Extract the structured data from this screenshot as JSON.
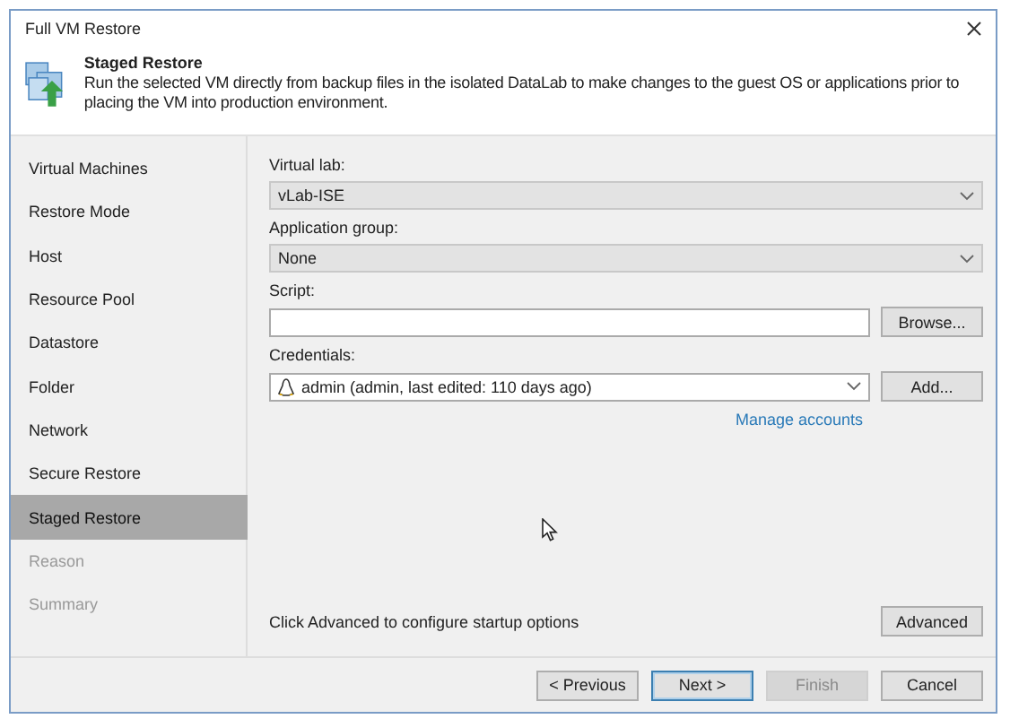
{
  "window": {
    "title": "Full VM Restore"
  },
  "header": {
    "title": "Staged Restore",
    "description": "Run the selected VM directly from backup files in the isolated DataLab to make changes to the guest OS or applications prior to placing the VM into production environment."
  },
  "steps": [
    {
      "label": "Virtual Machines",
      "selected": false,
      "disabled": false
    },
    {
      "label": "Restore Mode",
      "selected": false,
      "disabled": false
    },
    {
      "label": "Host",
      "selected": false,
      "disabled": false
    },
    {
      "label": "Resource Pool",
      "selected": false,
      "disabled": false
    },
    {
      "label": "Datastore",
      "selected": false,
      "disabled": false
    },
    {
      "label": "Folder",
      "selected": false,
      "disabled": false
    },
    {
      "label": "Network",
      "selected": false,
      "disabled": false
    },
    {
      "label": "Secure Restore",
      "selected": false,
      "disabled": false
    },
    {
      "label": "Staged Restore",
      "selected": true,
      "disabled": false
    },
    {
      "label": "Reason",
      "selected": false,
      "disabled": true
    },
    {
      "label": "Summary",
      "selected": false,
      "disabled": true
    }
  ],
  "fields": [
    {
      "kind": "combo",
      "label": "Virtual lab:",
      "value": "vLab-ISE"
    },
    {
      "kind": "combo",
      "label": "Application group:",
      "value": "None"
    },
    {
      "kind": "text",
      "label": "Script:",
      "button": "Browse..."
    },
    {
      "kind": "account",
      "label": "Credentials:",
      "value": "admin (admin, last edited: 110 days ago)",
      "button": "Add...",
      "link": "Manage accounts"
    }
  ],
  "advanced": {
    "text": "Click Advanced to configure startup options",
    "button": "Advanced"
  },
  "buttons": [
    {
      "label": "< Previous",
      "default": false,
      "disabled": false
    },
    {
      "label": "Next >",
      "default": true,
      "disabled": false
    },
    {
      "label": "Finish",
      "default": false,
      "disabled": true
    },
    {
      "label": "Cancel",
      "default": false,
      "disabled": false
    }
  ]
}
